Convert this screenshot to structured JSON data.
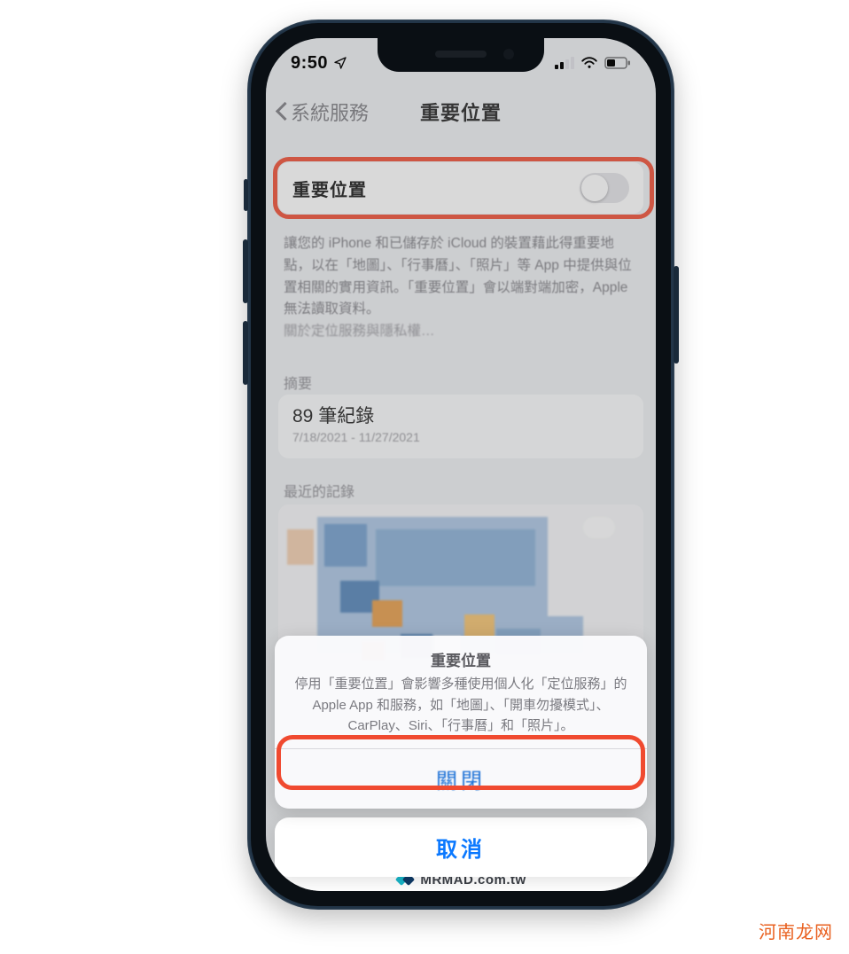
{
  "status": {
    "time": "9:50",
    "location_icon": "location-arrow",
    "cell_bars": 2,
    "wifi": true,
    "battery_pct": 42
  },
  "nav": {
    "back_label": "系統服務",
    "title": "重要位置"
  },
  "main": {
    "toggle_label": "重要位置",
    "toggle_on": false,
    "description": "讓您的 iPhone 和已儲存於 iCloud 的裝置藉此得重要地點，以在「地圖」、「行事曆」、「照片」等 App 中提供與位置相關的實用資訊。「重要位置」會以端對端加密，Apple 無法讀取資料。",
    "description_link": "關於定位服務與隱私權…",
    "summary_header": "摘要",
    "record_title": "89 筆紀錄",
    "record_subtitle": "7/18/2021 - 11/27/2021",
    "recent_header": "最近的記錄"
  },
  "sheet": {
    "title": "重要位置",
    "message": "停用「重要位置」會影響多種使用個人化「定位服務」的 Apple App 和服務，如「地圖」、「開車勿擾模式」、CarPlay、Siri、「行事曆」和「照片」。",
    "close_label": "關閉",
    "cancel_label": "取消"
  },
  "branding": "MRMAD.com.tw",
  "watermark": "河南龙网",
  "colors": {
    "highlight": "#f04a30",
    "link": "#0a78ff"
  }
}
